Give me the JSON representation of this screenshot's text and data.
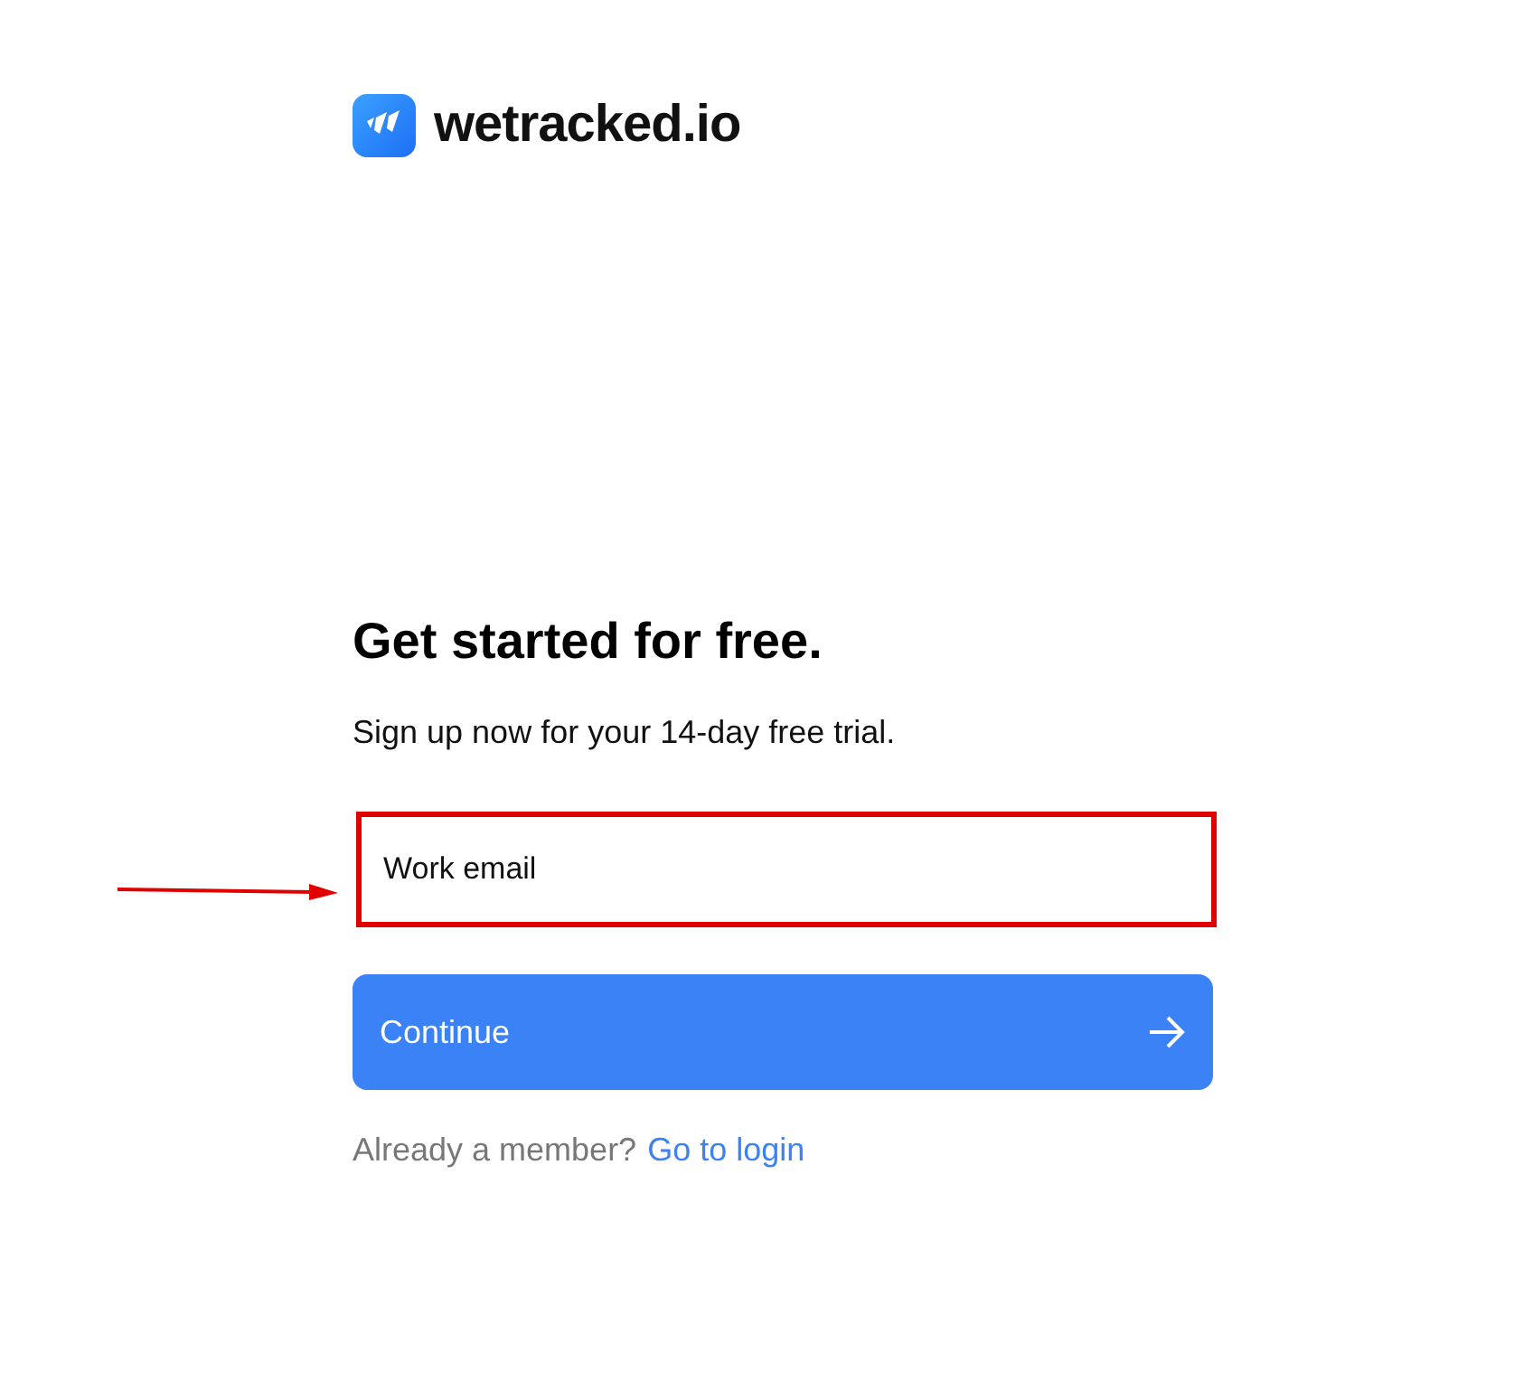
{
  "logo": {
    "text": "wetracked.io"
  },
  "heading": "Get started for free.",
  "subtitle": "Sign up now for your 14-day free trial.",
  "email_field": {
    "placeholder": "Work email",
    "annotated": true
  },
  "continue_button": {
    "label": "Continue"
  },
  "footer": {
    "text": "Already a member?",
    "link": "Go to login"
  }
}
